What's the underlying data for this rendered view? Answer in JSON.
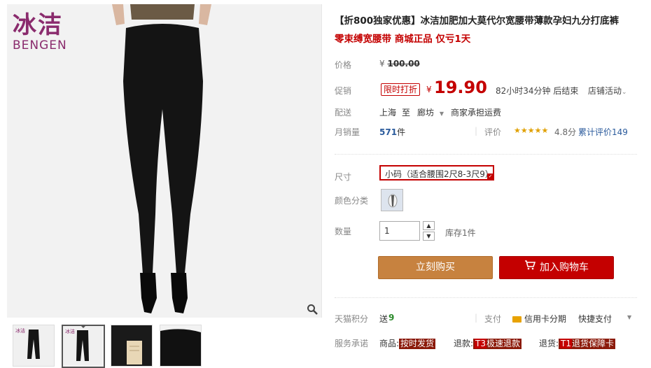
{
  "brand": {
    "logo_cn": "冰洁",
    "logo_en": "BENGEN"
  },
  "gallery": {
    "zoom_icon": "magnifier-icon",
    "thumbnails": [
      "thumb-1",
      "thumb-2",
      "thumb-3",
      "thumb-4"
    ],
    "active_index": 1
  },
  "product": {
    "title": "【折800独家优惠】冰洁加肥加大莫代尔宽腰带薄款孕妇九分打底裤",
    "subtitle": "零束缚宽腰带 商城正品 仅亏1天"
  },
  "price": {
    "label": "价格",
    "currency": "¥",
    "original": "100.00",
    "promo_label": "促销",
    "promo_tag": "限时打折",
    "current": "19.90",
    "countdown": "82小时34分钟 后结束",
    "shop_activity": "店铺活动",
    "chevron_icon": "chevron-down-icon"
  },
  "shipping": {
    "label": "配送",
    "from": "上海",
    "to_word": "至",
    "to": "廊坊",
    "fee": "商家承担运费"
  },
  "sales": {
    "label": "月销量",
    "count": "571",
    "unit": "件",
    "rating_label": "评价",
    "stars": 5,
    "score": "4.8分",
    "review_text": "累计评价",
    "review_count": "149"
  },
  "options": {
    "size_label": "尺寸",
    "size_value": "小码（适合腰围2尺8-3尺9）",
    "color_label": "颜色分类",
    "qty_label": "数量",
    "qty_value": "1",
    "stock": "库存1件"
  },
  "actions": {
    "buy": "立刻购买",
    "cart": "加入购物车",
    "cart_icon": "cart-icon"
  },
  "points": {
    "label": "天猫积分",
    "send": "送",
    "value": "9",
    "pay_label": "支付",
    "card_text": "信用卡分期",
    "quick_pay": "快捷支付"
  },
  "service": {
    "label": "服务承诺",
    "goods": "商品:",
    "goods_badge": "按时发货",
    "refund": "退款:",
    "refund_badge_code": "T3",
    "refund_badge": "极速退款",
    "return": "退货:",
    "return_badge_code": "T1",
    "return_badge": "退货保障卡"
  },
  "colors": {
    "accent_red": "#c40000",
    "buy_orange": "#c7823f",
    "logo_purple": "#8a2b6d"
  }
}
